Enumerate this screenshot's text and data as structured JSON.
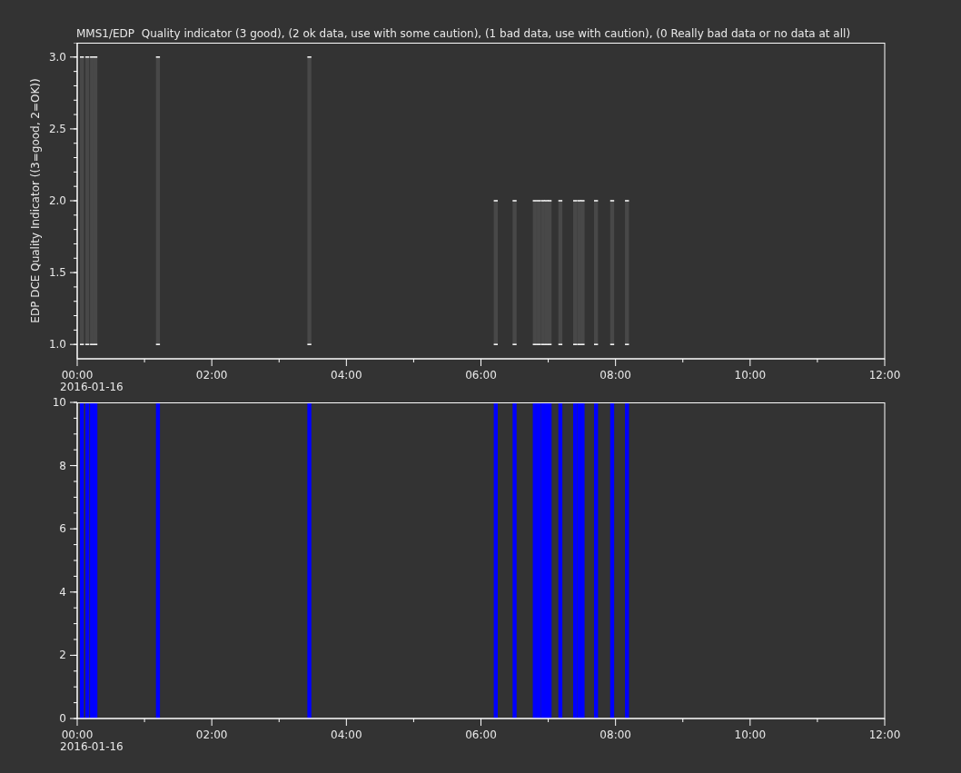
{
  "title": "MMS1/EDP  Quality indicator (3 good), (2 ok data, use with some caution), (1 bad data, use with caution), (0 Really bad data or no data at all)",
  "panels": [
    {
      "date_label": "2016-01-16",
      "chart_data": {
        "type": "area",
        "ylabel": "EDP DCE Quality Indicator ((3=good, 2=OK))",
        "x": [
          0.07,
          0.15,
          0.22,
          0.27,
          1.2,
          3.45,
          6.22,
          6.5,
          6.8,
          6.86,
          6.92,
          6.97,
          7.02,
          7.18,
          7.4,
          7.46,
          7.51,
          7.71,
          7.95,
          8.17
        ],
        "series": [
          {
            "color": "#484848",
            "values": [
              3,
              3,
              3,
              3,
              3,
              3,
              2,
              2,
              2,
              2,
              2,
              2,
              2,
              2,
              2,
              2,
              2,
              2,
              2,
              2
            ]
          }
        ],
        "xlim": [
          0,
          12
        ],
        "ylim": [
          0.9,
          3.1
        ],
        "xticks": [
          {
            "value": 0,
            "label": "00:00"
          },
          {
            "value": 2,
            "label": "02:00"
          },
          {
            "value": 4,
            "label": "04:00"
          },
          {
            "value": 6,
            "label": "06:00"
          },
          {
            "value": 8,
            "label": "08:00"
          },
          {
            "value": 10,
            "label": "10:00"
          },
          {
            "value": 12,
            "label": "12:00"
          }
        ],
        "yticks": [
          {
            "value": 1,
            "label": "1.0"
          },
          {
            "value": 1.5,
            "label": "1.5"
          },
          {
            "value": 2,
            "label": "2.0"
          },
          {
            "value": 2.5,
            "label": "2.5"
          },
          {
            "value": 3,
            "label": "3.0"
          }
        ]
      }
    },
    {
      "date_label": "2016-01-16",
      "chart_data": {
        "type": "bar",
        "x": [
          0.07,
          0.15,
          0.22,
          0.27,
          1.2,
          3.45,
          6.22,
          6.5,
          6.8,
          6.86,
          6.92,
          6.97,
          7.02,
          7.18,
          7.4,
          7.46,
          7.51,
          7.71,
          7.95,
          8.17
        ],
        "series": [
          {
            "color": "#0000ff",
            "values": [
              10,
              10,
              10,
              10,
              10,
              10,
              10,
              10,
              10,
              10,
              10,
              10,
              10,
              10,
              10,
              10,
              10,
              10,
              10,
              10
            ]
          }
        ],
        "xlim": [
          0,
          12
        ],
        "ylim": [
          0,
          10
        ],
        "xticks": [
          {
            "value": 0,
            "label": "00:00"
          },
          {
            "value": 2,
            "label": "02:00"
          },
          {
            "value": 4,
            "label": "04:00"
          },
          {
            "value": 6,
            "label": "06:00"
          },
          {
            "value": 8,
            "label": "08:00"
          },
          {
            "value": 10,
            "label": "10:00"
          },
          {
            "value": 12,
            "label": "12:00"
          }
        ],
        "yticks": [
          {
            "value": 0,
            "label": "0"
          },
          {
            "value": 2,
            "label": "2"
          },
          {
            "value": 4,
            "label": "4"
          },
          {
            "value": 6,
            "label": "6"
          },
          {
            "value": 8,
            "label": "8"
          },
          {
            "value": 10,
            "label": "10"
          }
        ]
      }
    }
  ]
}
